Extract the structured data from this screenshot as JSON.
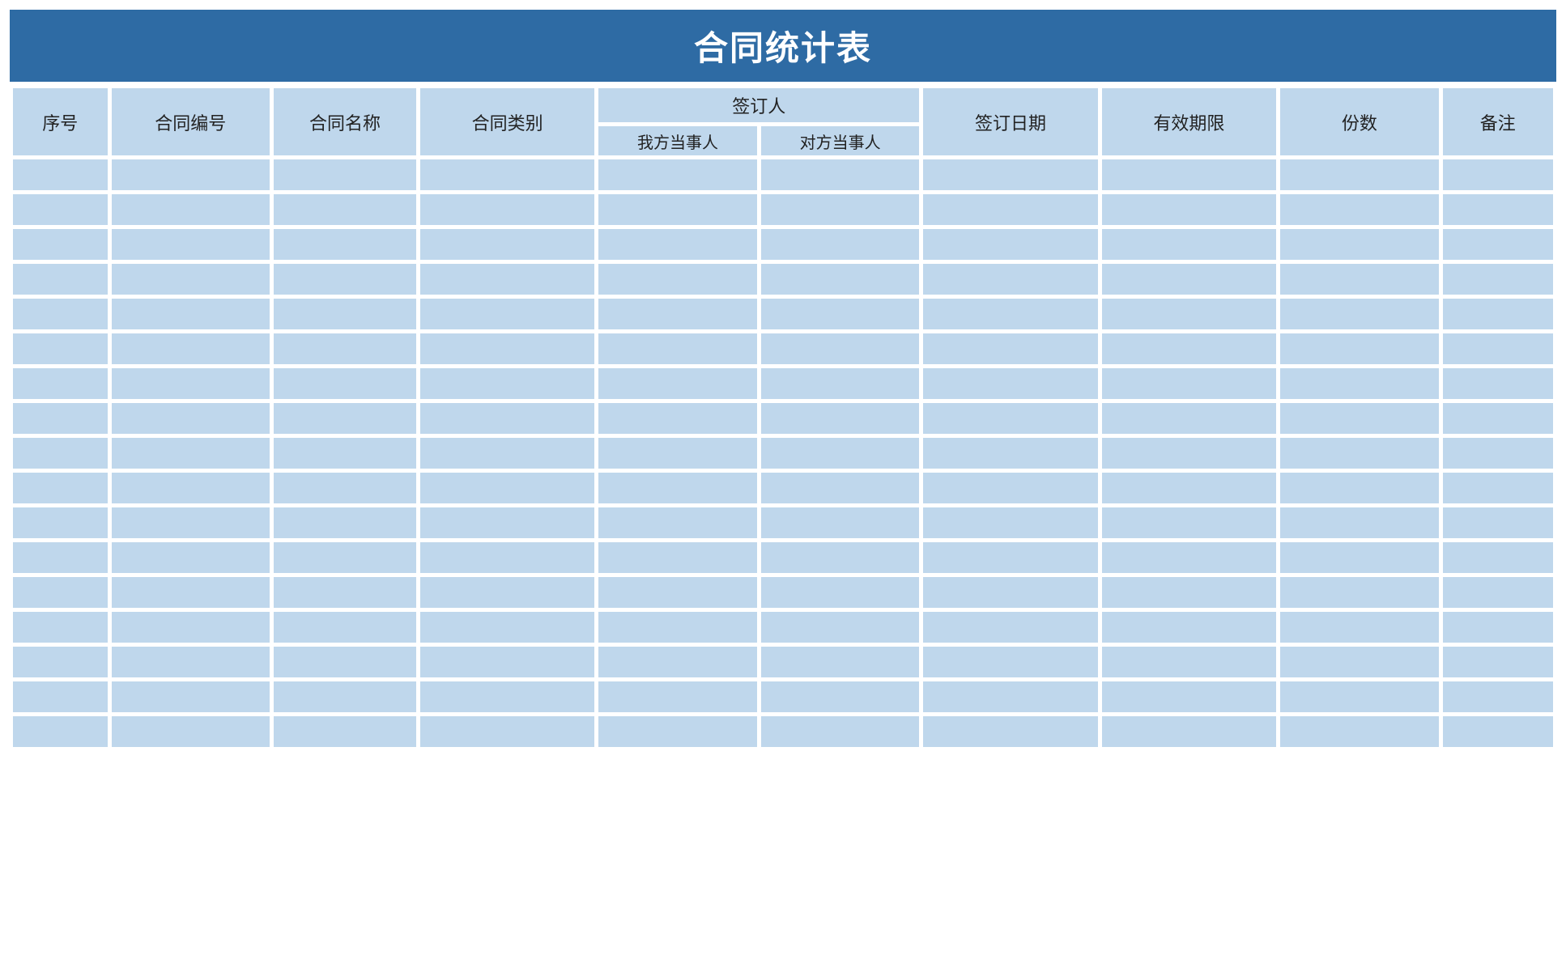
{
  "title": "合同统计表",
  "headers": {
    "seq": "序号",
    "contract_id": "合同编号",
    "contract_name": "合同名称",
    "contract_type": "合同类别",
    "signer": "签订人",
    "our_party": "我方当事人",
    "other_party": "对方当事人",
    "sign_date": "签订日期",
    "valid_period": "有效期限",
    "copies": "份数",
    "remark": "备注"
  },
  "rows": [
    {
      "seq": "",
      "contract_id": "",
      "contract_name": "",
      "contract_type": "",
      "our_party": "",
      "other_party": "",
      "sign_date": "",
      "valid_period": "",
      "copies": "",
      "remark": ""
    },
    {
      "seq": "",
      "contract_id": "",
      "contract_name": "",
      "contract_type": "",
      "our_party": "",
      "other_party": "",
      "sign_date": "",
      "valid_period": "",
      "copies": "",
      "remark": ""
    },
    {
      "seq": "",
      "contract_id": "",
      "contract_name": "",
      "contract_type": "",
      "our_party": "",
      "other_party": "",
      "sign_date": "",
      "valid_period": "",
      "copies": "",
      "remark": ""
    },
    {
      "seq": "",
      "contract_id": "",
      "contract_name": "",
      "contract_type": "",
      "our_party": "",
      "other_party": "",
      "sign_date": "",
      "valid_period": "",
      "copies": "",
      "remark": ""
    },
    {
      "seq": "",
      "contract_id": "",
      "contract_name": "",
      "contract_type": "",
      "our_party": "",
      "other_party": "",
      "sign_date": "",
      "valid_period": "",
      "copies": "",
      "remark": ""
    },
    {
      "seq": "",
      "contract_id": "",
      "contract_name": "",
      "contract_type": "",
      "our_party": "",
      "other_party": "",
      "sign_date": "",
      "valid_period": "",
      "copies": "",
      "remark": ""
    },
    {
      "seq": "",
      "contract_id": "",
      "contract_name": "",
      "contract_type": "",
      "our_party": "",
      "other_party": "",
      "sign_date": "",
      "valid_period": "",
      "copies": "",
      "remark": ""
    },
    {
      "seq": "",
      "contract_id": "",
      "contract_name": "",
      "contract_type": "",
      "our_party": "",
      "other_party": "",
      "sign_date": "",
      "valid_period": "",
      "copies": "",
      "remark": ""
    },
    {
      "seq": "",
      "contract_id": "",
      "contract_name": "",
      "contract_type": "",
      "our_party": "",
      "other_party": "",
      "sign_date": "",
      "valid_period": "",
      "copies": "",
      "remark": ""
    },
    {
      "seq": "",
      "contract_id": "",
      "contract_name": "",
      "contract_type": "",
      "our_party": "",
      "other_party": "",
      "sign_date": "",
      "valid_period": "",
      "copies": "",
      "remark": ""
    },
    {
      "seq": "",
      "contract_id": "",
      "contract_name": "",
      "contract_type": "",
      "our_party": "",
      "other_party": "",
      "sign_date": "",
      "valid_period": "",
      "copies": "",
      "remark": ""
    },
    {
      "seq": "",
      "contract_id": "",
      "contract_name": "",
      "contract_type": "",
      "our_party": "",
      "other_party": "",
      "sign_date": "",
      "valid_period": "",
      "copies": "",
      "remark": ""
    },
    {
      "seq": "",
      "contract_id": "",
      "contract_name": "",
      "contract_type": "",
      "our_party": "",
      "other_party": "",
      "sign_date": "",
      "valid_period": "",
      "copies": "",
      "remark": ""
    },
    {
      "seq": "",
      "contract_id": "",
      "contract_name": "",
      "contract_type": "",
      "our_party": "",
      "other_party": "",
      "sign_date": "",
      "valid_period": "",
      "copies": "",
      "remark": ""
    },
    {
      "seq": "",
      "contract_id": "",
      "contract_name": "",
      "contract_type": "",
      "our_party": "",
      "other_party": "",
      "sign_date": "",
      "valid_period": "",
      "copies": "",
      "remark": ""
    },
    {
      "seq": "",
      "contract_id": "",
      "contract_name": "",
      "contract_type": "",
      "our_party": "",
      "other_party": "",
      "sign_date": "",
      "valid_period": "",
      "copies": "",
      "remark": ""
    },
    {
      "seq": "",
      "contract_id": "",
      "contract_name": "",
      "contract_type": "",
      "our_party": "",
      "other_party": "",
      "sign_date": "",
      "valid_period": "",
      "copies": "",
      "remark": ""
    }
  ]
}
